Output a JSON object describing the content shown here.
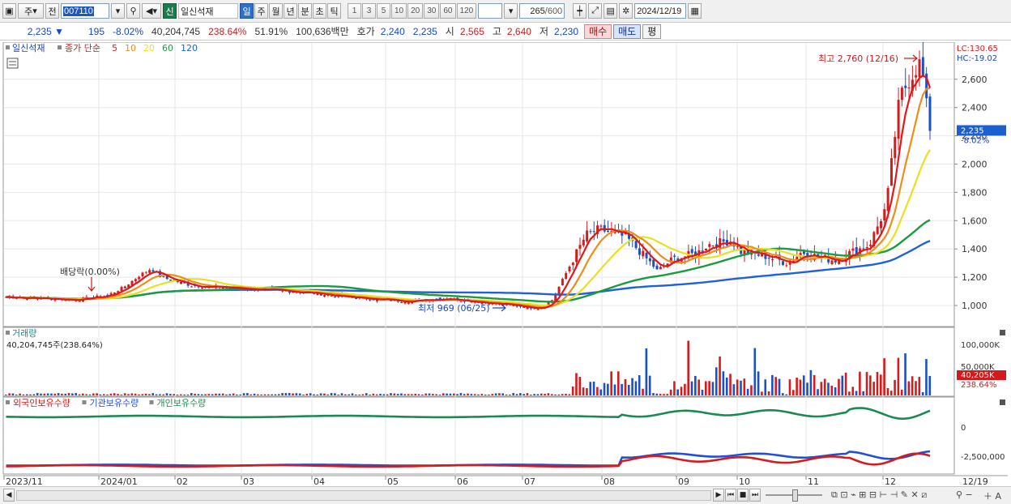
{
  "toolbar": {
    "market": "주",
    "prev": "전",
    "code": "007110",
    "credit_label": "신",
    "name": "일신석재",
    "periods": [
      "일",
      "주",
      "월",
      "년",
      "분",
      "초",
      "틱"
    ],
    "intervals": [
      "1",
      "3",
      "5",
      "10",
      "20",
      "30",
      "60",
      "120"
    ],
    "count": "265",
    "count_total": "/600",
    "date": "2024/12/19"
  },
  "quote": {
    "price": "2,235",
    "change": "195",
    "change_pct": "-8.02%",
    "volume": "40,204,745",
    "vol_ratio": "238.64%",
    "turnover": "51.91%",
    "amount": "100,636백만",
    "ask_label": "호가",
    "ask": "2,240",
    "bid": "2,235",
    "open_label": "시",
    "open": "2,565",
    "high_label": "고",
    "high": "2,640",
    "low_label": "저",
    "low": "2,230",
    "buy_label": "매수",
    "sell_label": "매도",
    "avg_label": "평"
  },
  "price_panel": {
    "legend_name": "일신석재",
    "legend_type": "종가 단순",
    "ma_labels": [
      {
        "label": "5",
        "color": "#e01818"
      },
      {
        "label": "10",
        "color": "#f08c18"
      },
      {
        "label": "20",
        "color": "#e8e020"
      },
      {
        "label": "60",
        "color": "#1c9a40"
      },
      {
        "label": "120",
        "color": "#2060d8"
      }
    ],
    "lc": "LC:130.65",
    "hc": "HC:-19.02",
    "high_note": "최고 2,760 (12/16)",
    "low_note": "최저 969 (06/25)",
    "dividend_note": "배당락(0.00%)",
    "last_price": "2,235",
    "last_pct": "-8.02%",
    "y_ticks": [
      "2,600",
      "2,400",
      "2,200",
      "2,000",
      "1,800",
      "1,600",
      "1,400",
      "1,200",
      "1,000"
    ]
  },
  "volume_panel": {
    "title": "거래량",
    "info": "40,204,745주(238.64%)",
    "ticks": [
      "100,000K",
      "50,000K"
    ],
    "last_vol": "40,205K",
    "last_pct": "238.64%"
  },
  "holding_panel": {
    "legends": [
      {
        "label": "외국인보유수량",
        "color": "#d41c1c"
      },
      {
        "label": "기관보유수량",
        "color": "#2050d8"
      },
      {
        "label": "개인보유수량",
        "color": "#1c8a50"
      }
    ],
    "ticks": [
      "0",
      "-2,500,000"
    ]
  },
  "x_axis": {
    "labels": [
      "2023/11",
      "2024/01",
      "02",
      "03",
      "04",
      "05",
      "06",
      "07",
      "08",
      "09",
      "10",
      "11",
      "12"
    ],
    "end_label": "12/19"
  },
  "colors": {
    "up": "#d41c1c",
    "down": "#1c50c8",
    "ma5": "#e01818",
    "ma10": "#f08c18",
    "ma20": "#e8e020",
    "ma60": "#1c9a40",
    "ma120": "#2060d8",
    "accent": "#2f6fce"
  },
  "icons": [
    "window-icon",
    "search-icon",
    "speaker-icon",
    "candle-icon",
    "link-icon",
    "save-icon",
    "gear-icon",
    "calendar-icon",
    "grid-icon",
    "zoom-out-icon",
    "zoom-in-icon"
  ]
}
